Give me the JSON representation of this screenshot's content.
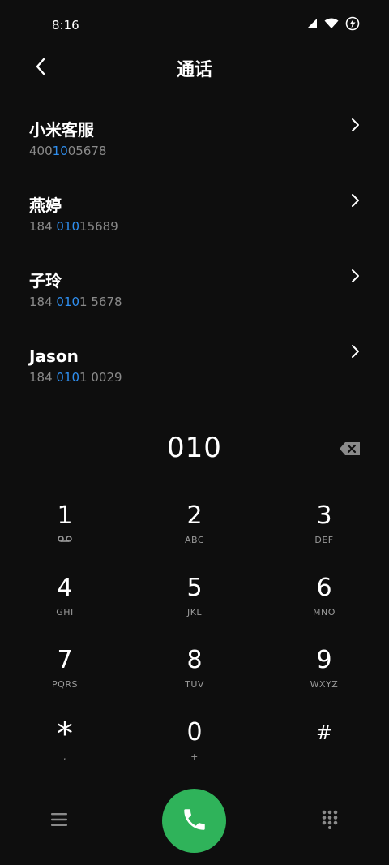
{
  "status_bar": {
    "time": "8:16",
    "icons": [
      "signal-icon",
      "wifi-icon",
      "battery-charging-icon"
    ]
  },
  "header": {
    "title": "通话",
    "back_icon": "back-arrow-icon"
  },
  "contacts": [
    {
      "name": "小米客服",
      "number_parts": [
        "400",
        "1",
        "0",
        "05678"
      ],
      "highlight_idx": [
        1,
        2
      ]
    },
    {
      "name": "燕婷",
      "number_parts": [
        "184 ",
        "010",
        "15689"
      ],
      "highlight_idx": [
        1
      ]
    },
    {
      "name": "子玲",
      "number_parts": [
        "184 ",
        "010",
        "1 5678"
      ],
      "highlight_idx": [
        1
      ]
    },
    {
      "name": "Jason",
      "number_parts": [
        "184 ",
        "010",
        "1 0029"
      ],
      "highlight_idx": [
        1
      ]
    }
  ],
  "dialer": {
    "number": "010",
    "keys": [
      {
        "digit": "1",
        "letters": "voicemail-icon"
      },
      {
        "digit": "2",
        "letters": "ABC"
      },
      {
        "digit": "3",
        "letters": "DEF"
      },
      {
        "digit": "4",
        "letters": "GHI"
      },
      {
        "digit": "5",
        "letters": "JKL"
      },
      {
        "digit": "6",
        "letters": "MNO"
      },
      {
        "digit": "7",
        "letters": "PQRS"
      },
      {
        "digit": "8",
        "letters": "TUV"
      },
      {
        "digit": "9",
        "letters": "WXYZ"
      },
      {
        "digit": "*",
        "letters": ","
      },
      {
        "digit": "0",
        "letters": "+"
      },
      {
        "digit": "#",
        "letters": ""
      }
    ]
  },
  "bottom_bar": {
    "menu_icon": "menu-icon",
    "call_icon": "phone-icon",
    "keypad_icon": "dialpad-icon"
  },
  "colors": {
    "background": "#0e0e0e",
    "highlight": "#2f8ff0",
    "call_button": "#2fb35a",
    "secondary_text": "#8a8a8a"
  }
}
